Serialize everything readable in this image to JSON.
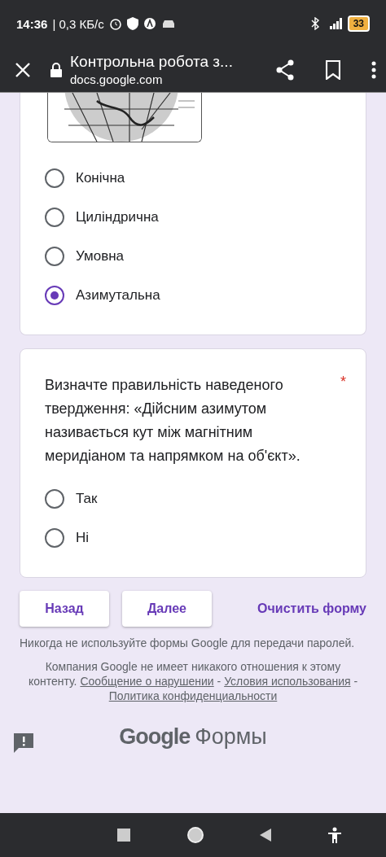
{
  "status_bar": {
    "time": "14:36",
    "speed": "| 0,3 КБ/с",
    "battery": "33"
  },
  "toolbar": {
    "title": "Контрольна робота з...",
    "url": "docs.google.com"
  },
  "question_1": {
    "options": [
      {
        "label": "Конічна",
        "selected": false
      },
      {
        "label": "Циліндрична",
        "selected": false
      },
      {
        "label": "Умовна",
        "selected": false
      },
      {
        "label": "Азимутальна",
        "selected": true
      }
    ]
  },
  "question_2": {
    "title": "Визначте правильність наведеного твердження: «Дійсним азимутом називається кут між магнітним меридіаном та напрямком на об'єкт».",
    "required_mark": "*",
    "options": [
      {
        "label": "Так",
        "selected": false
      },
      {
        "label": "Ні",
        "selected": false
      }
    ]
  },
  "buttons": [
    {
      "label": "Назад",
      "kind": "raised"
    },
    {
      "label": "Далее",
      "kind": "raised"
    },
    {
      "label": "Очистить форму",
      "kind": "text"
    }
  ],
  "password_notice": "Никогда не используйте формы Google для передачи паролей.",
  "footer": [
    {
      "kind": "text",
      "text": "Компания Google не имеет никакого отношения к этому контенту."
    },
    {
      "kind": "link",
      "text": "Сообщение о нарушении"
    },
    {
      "kind": "text",
      "text": "-"
    },
    {
      "kind": "link",
      "text": "Условия использования"
    },
    {
      "kind": "text",
      "text": "-"
    },
    {
      "kind": "link",
      "text": "Политика конфиденциальности"
    }
  ],
  "logo": {
    "brand": "Google",
    "product": "Формы"
  }
}
